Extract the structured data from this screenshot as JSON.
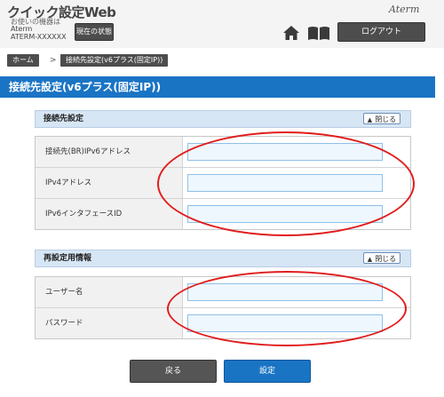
{
  "header": {
    "app_title": "クイック設定Web",
    "device_caption": "お使いの機器は",
    "device_name_line1": "Aterm",
    "device_name_line2": "ATERM-XXXXXX",
    "status_button": "現在の状態",
    "logo": "Aterm",
    "logout_button": "ログアウト"
  },
  "breadcrumb": {
    "home": "ホーム",
    "separator": ">",
    "current": "接続先設定(v6プラス(固定IP))"
  },
  "page_title": "接続先設定(v6プラス(固定IP))",
  "sections": [
    {
      "title": "接続先設定",
      "collapse_label": "閉じる",
      "fields": [
        {
          "label": "接続先(BR)IPv6アドレス",
          "value": ""
        },
        {
          "label": "IPv4アドレス",
          "value": ""
        },
        {
          "label": "IPv6インタフェースID",
          "value": ""
        }
      ]
    },
    {
      "title": "再設定用情報",
      "collapse_label": "閉じる",
      "fields": [
        {
          "label": "ユーザー名",
          "value": ""
        },
        {
          "label": "パスワード",
          "value": ""
        }
      ]
    }
  ],
  "buttons": {
    "back": "戻る",
    "submit": "設定"
  },
  "colors": {
    "title_bar": "#1a74c4",
    "section_header": "#d7e6f5",
    "annotation": "#e11d1d",
    "dark_button": "#4d4d4d"
  },
  "icons": [
    "home-icon",
    "book-icon",
    "chevron-up-icon"
  ]
}
